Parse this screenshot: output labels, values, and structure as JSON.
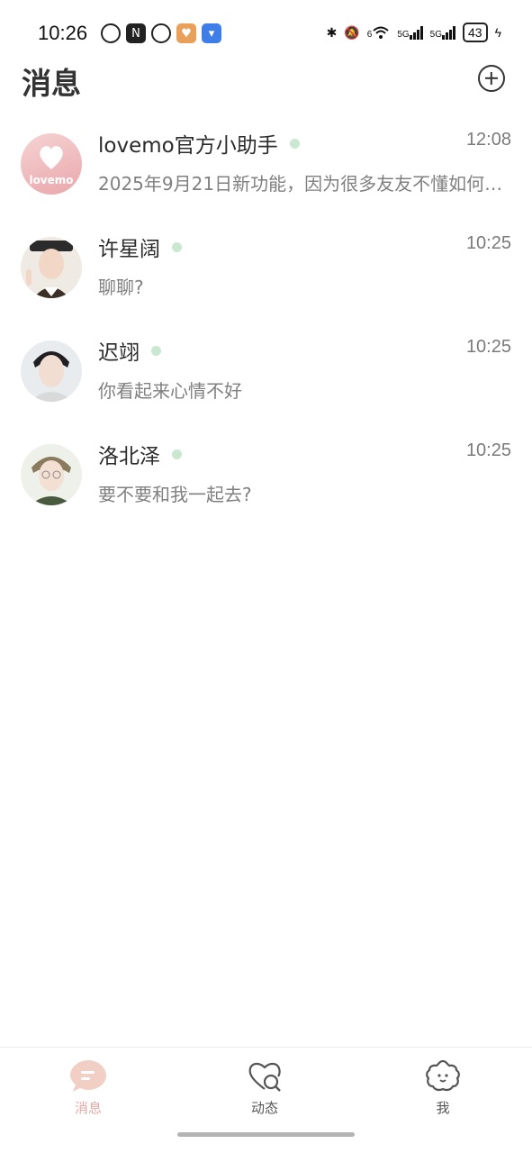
{
  "status_bar": {
    "time": "10:26",
    "network_1": "6",
    "network_2": "5G",
    "network_3": "5G",
    "battery": "43"
  },
  "header": {
    "title": "消息",
    "add_icon": "plus-circle-icon"
  },
  "conversations": [
    {
      "name": "lovemo官方小助手",
      "time": "12:08",
      "message": "2025年9月21日新功能，因为很多友友不懂如何使用……",
      "avatar_text": "lovemo"
    },
    {
      "name": "许星阔",
      "time": "10:25",
      "message": "聊聊?"
    },
    {
      "name": "迟翊",
      "time": "10:25",
      "message": "你看起来心情不好"
    },
    {
      "name": "洛北泽",
      "time": "10:25",
      "message": "要不要和我一起去?"
    }
  ],
  "tabbar": {
    "tabs": [
      {
        "label": "消息",
        "icon": "chat-bubble-icon",
        "active": true
      },
      {
        "label": "动态",
        "icon": "heart-search-icon",
        "active": false
      },
      {
        "label": "我",
        "icon": "smiley-cloud-icon",
        "active": false
      }
    ]
  },
  "colors": {
    "accent": "#e6a9a4",
    "online": "#c9e8cf",
    "text_primary": "#2b2b2b",
    "text_secondary": "#808080"
  }
}
